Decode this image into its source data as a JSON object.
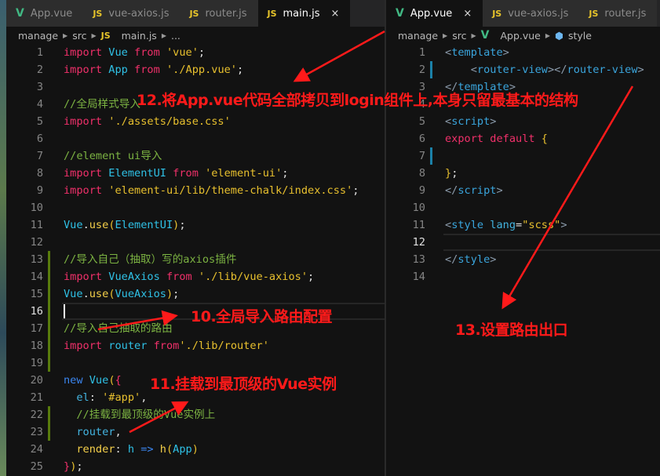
{
  "left_pane": {
    "tabs": [
      {
        "label": "App.vue",
        "icon": "vue-icon"
      },
      {
        "label": "vue-axios.js",
        "icon": "js-icon"
      },
      {
        "label": "router.js",
        "icon": "js-icon"
      },
      {
        "label": "main.js",
        "icon": "js-icon",
        "active": true,
        "close": "×"
      }
    ],
    "breadcrumb": [
      "manage",
      "src",
      "main.js",
      "..."
    ],
    "current_line": 16,
    "lines": [
      [
        [
          "import ",
          "kw"
        ],
        [
          "Vue ",
          "id"
        ],
        [
          "from ",
          "kw"
        ],
        [
          "'vue'",
          "str"
        ],
        [
          ";",
          "pn"
        ]
      ],
      [
        [
          "import ",
          "kw"
        ],
        [
          "App ",
          "id"
        ],
        [
          "from ",
          "kw"
        ],
        [
          "'./App.vue'",
          "str"
        ],
        [
          ";",
          "pn"
        ]
      ],
      [],
      [
        [
          "//全局样式导入",
          "cm"
        ]
      ],
      [
        [
          "import ",
          "kw"
        ],
        [
          "'./assets/base.css'",
          "str"
        ]
      ],
      [],
      [
        [
          "//element ui导入",
          "cm"
        ]
      ],
      [
        [
          "import ",
          "kw"
        ],
        [
          "ElementUI ",
          "id"
        ],
        [
          "from ",
          "kw"
        ],
        [
          "'element-ui'",
          "str"
        ],
        [
          ";",
          "pn"
        ]
      ],
      [
        [
          "import ",
          "kw"
        ],
        [
          "'element-ui/lib/theme-chalk/index.css'",
          "str"
        ],
        [
          ";",
          "pn"
        ]
      ],
      [],
      [
        [
          "Vue",
          "id"
        ],
        [
          ".",
          "pn"
        ],
        [
          "use",
          "fn"
        ],
        [
          "(",
          "br"
        ],
        [
          "ElementUI",
          "id"
        ],
        [
          ")",
          "br"
        ],
        [
          ";",
          "pn"
        ]
      ],
      [],
      [
        [
          "//导入自己（抽取）写的axios插件",
          "cm"
        ]
      ],
      [
        [
          "import ",
          "kw"
        ],
        [
          "VueAxios ",
          "id"
        ],
        [
          "from ",
          "kw"
        ],
        [
          "'./lib/vue-axios'",
          "str"
        ],
        [
          ";",
          "pn"
        ]
      ],
      [
        [
          "Vue",
          "id"
        ],
        [
          ".",
          "pn"
        ],
        [
          "use",
          "fn"
        ],
        [
          "(",
          "br"
        ],
        [
          "VueAxios",
          "id"
        ],
        [
          ")",
          "br"
        ],
        [
          ";",
          "pn"
        ]
      ],
      [],
      [
        [
          "//导入自己抽取的路由",
          "cm"
        ]
      ],
      [
        [
          "import ",
          "kw"
        ],
        [
          "router ",
          "id"
        ],
        [
          "from",
          "kw"
        ],
        [
          "'./lib/router'",
          "str"
        ]
      ],
      [],
      [
        [
          "new ",
          "nw"
        ],
        [
          "Vue",
          "id"
        ],
        [
          "(",
          "br"
        ],
        [
          "{",
          "kw"
        ]
      ],
      [
        [
          "  el",
          "at"
        ],
        [
          ": ",
          "pn"
        ],
        [
          "'#app'",
          "str"
        ],
        [
          ",",
          "pn"
        ]
      ],
      [
        [
          "  //挂载到最顶级的Vue实例上",
          "cm"
        ]
      ],
      [
        [
          "  router",
          "at"
        ],
        [
          ",",
          "pn"
        ]
      ],
      [
        [
          "  render",
          "fn"
        ],
        [
          ": ",
          "pn"
        ],
        [
          "h ",
          "id"
        ],
        [
          "=> ",
          "nw"
        ],
        [
          "h",
          "fn"
        ],
        [
          "(",
          "br"
        ],
        [
          "App",
          "id"
        ],
        [
          ")",
          "br"
        ]
      ],
      [
        [
          "}",
          "kw"
        ],
        [
          ")",
          "br"
        ],
        [
          ";",
          "pn"
        ]
      ]
    ],
    "git_added_lines": [
      13,
      14,
      15,
      16,
      17,
      18,
      19,
      22,
      23
    ]
  },
  "right_pane": {
    "tabs": [
      {
        "label": "App.vue",
        "icon": "vue-icon",
        "active": true,
        "close": "×"
      },
      {
        "label": "vue-axios.js",
        "icon": "js-icon"
      },
      {
        "label": "router.js",
        "icon": "js-icon"
      }
    ],
    "breadcrumb": [
      "manage",
      "src",
      "App.vue",
      "style"
    ],
    "current_line": 12,
    "lines": [
      [
        [
          "<",
          "tg"
        ],
        [
          "template",
          "tn"
        ],
        [
          ">",
          "tg"
        ]
      ],
      [
        [
          "    <",
          "tg"
        ],
        [
          "router-view",
          "tn"
        ],
        [
          "></",
          "tg"
        ],
        [
          "router-view",
          "tn"
        ],
        [
          ">",
          "tg"
        ]
      ],
      [
        [
          "</",
          "tg"
        ],
        [
          "template",
          "tn"
        ],
        [
          ">",
          "tg"
        ]
      ],
      [],
      [
        [
          "<",
          "tg"
        ],
        [
          "script",
          "tn"
        ],
        [
          ">",
          "tg"
        ]
      ],
      [
        [
          "export ",
          "kw"
        ],
        [
          "default ",
          "kw"
        ],
        [
          "{",
          "br"
        ]
      ],
      [],
      [
        [
          "}",
          "br"
        ],
        [
          ";",
          "pn"
        ]
      ],
      [
        [
          "</",
          "tg"
        ],
        [
          "script",
          "tn"
        ],
        [
          ">",
          "tg"
        ]
      ],
      [],
      [
        [
          "<",
          "tg"
        ],
        [
          "style ",
          "tn"
        ],
        [
          "lang",
          "at"
        ],
        [
          "=",
          "pn"
        ],
        [
          "\"scss\"",
          "str"
        ],
        [
          ">",
          "tg"
        ]
      ],
      [],
      [
        [
          "</",
          "tg"
        ],
        [
          "style",
          "tn"
        ],
        [
          ">",
          "tg"
        ]
      ],
      []
    ],
    "git_modified_lines": [
      2,
      7
    ]
  },
  "annotations": {
    "a12": "12.将App.vue代码全部拷贝到login组件上,本身只留最基本的结构",
    "a10": "10.全局导入路由配置",
    "a11": "11.挂载到最顶级的Vue实例",
    "a13": "13.设置路由出口"
  },
  "colors": {
    "annotation": "#ff1a1a",
    "git_added": "#587c0c",
    "git_modified": "#1b81a8"
  }
}
